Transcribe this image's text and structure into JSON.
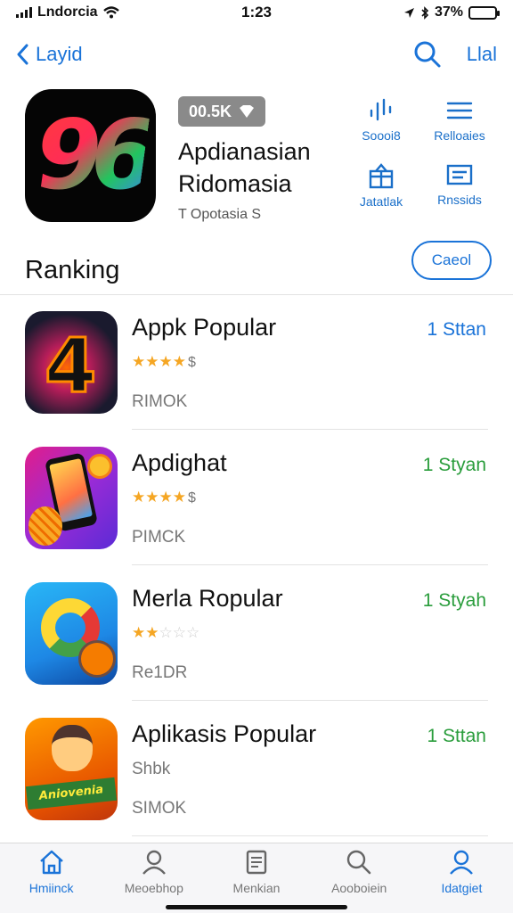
{
  "status_bar": {
    "carrier": "Lndorcia",
    "time": "1:23",
    "battery": "37%",
    "battery_level": 0.37
  },
  "nav": {
    "back_label": "Layid",
    "right_label": "Llal"
  },
  "hero": {
    "icon_text": "96",
    "price": "00.5K",
    "title": "Apdianasian Ridomasia",
    "subtitle": "T Opotasia S"
  },
  "actions": [
    {
      "label": "Soooi8",
      "icon": "signal-bars-icon"
    },
    {
      "label": "Relloaies",
      "icon": "menu-lines-icon"
    },
    {
      "label": "Jatatlak",
      "icon": "gift-box-icon"
    },
    {
      "label": "Rnssids",
      "icon": "list-card-icon"
    }
  ],
  "ranking": {
    "title": "Ranking",
    "button": "Caeol"
  },
  "apps": [
    {
      "name": "Appk Popular",
      "rating": 4,
      "stars_text": "★★★★",
      "symbol": "$",
      "size": "RIMOK",
      "action": "1 Sttan",
      "action_color": "#1a73d8"
    },
    {
      "name": "Apdighat",
      "rating": 4,
      "stars_text": "★★★★",
      "symbol": "$",
      "size": "PIMCK",
      "action": "1 Styan",
      "action_color": "#2a9d3c"
    },
    {
      "name": "Merla Ropular",
      "rating": 2,
      "stars_text": "★★",
      "stars_off": "☆☆☆",
      "size": "Re1DR",
      "action": "1 Styah",
      "action_color": "#2a9d3c"
    },
    {
      "name": "Aplikasis Popular",
      "rating_text": "Shbk",
      "size": "SIMOK",
      "action": "1 Sttan",
      "action_color": "#2a9d3c",
      "banner": "Aniovenia"
    }
  ],
  "tabs": [
    {
      "label": "Hmiinck",
      "icon": "home-icon"
    },
    {
      "label": "Meoebhop",
      "icon": "person-icon"
    },
    {
      "label": "Menkian",
      "icon": "document-icon"
    },
    {
      "label": "Aooboiein",
      "icon": "search-icon"
    },
    {
      "label": "Idatgiet",
      "icon": "account-icon"
    }
  ],
  "colors": {
    "accent": "#1a73d8",
    "green": "#2a9d3c",
    "star": "#f5a623"
  }
}
